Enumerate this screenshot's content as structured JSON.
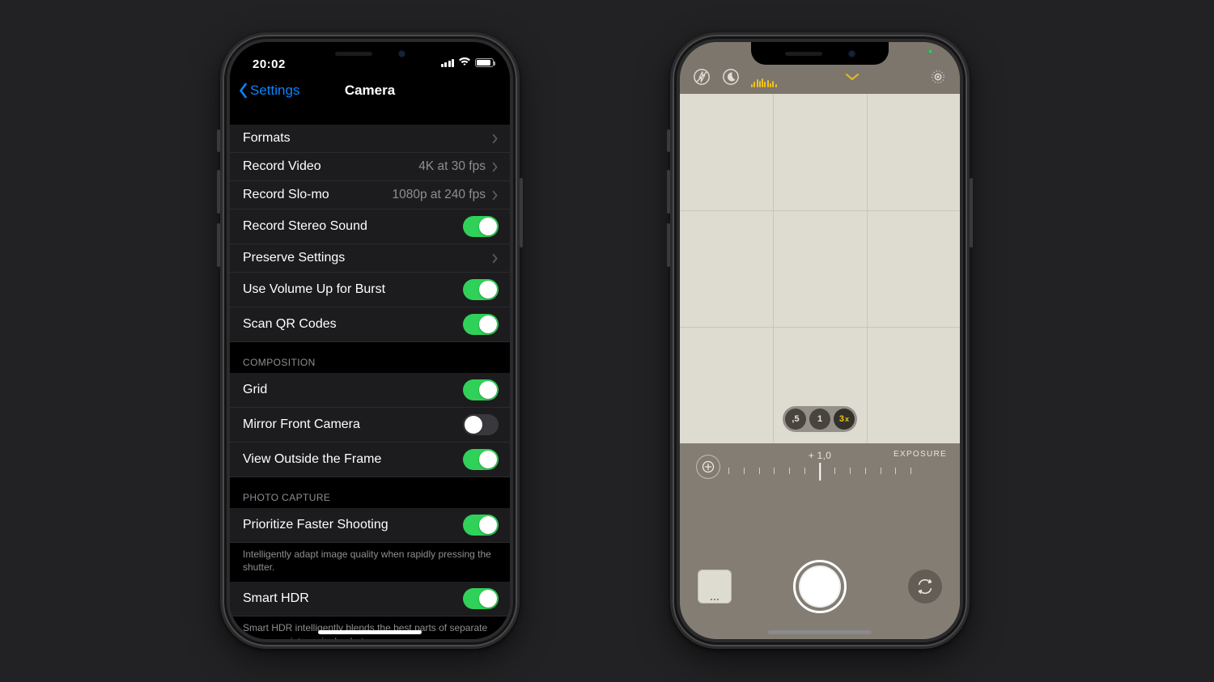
{
  "settings": {
    "status_time": "20:02",
    "back_label": "Settings",
    "title": "Camera",
    "rows": {
      "formats": "Formats",
      "record_video": "Record Video",
      "record_video_value": "4K at 30 fps",
      "record_slomo": "Record Slo-mo",
      "record_slomo_value": "1080p at 240 fps",
      "stereo": "Record Stereo Sound",
      "preserve": "Preserve Settings",
      "volume_burst": "Use Volume Up for Burst",
      "scan_qr": "Scan QR Codes"
    },
    "section_composition": "Composition",
    "composition": {
      "grid": "Grid",
      "mirror": "Mirror Front Camera",
      "outside": "View Outside the Frame"
    },
    "section_capture": "Photo Capture",
    "capture": {
      "faster": "Prioritize Faster Shooting",
      "faster_footer": "Intelligently adapt image quality when rapidly pressing the shutter.",
      "smart_hdr": "Smart HDR",
      "hdr_footer": "Smart HDR intelligently blends the best parts of separate exposures into a single photo."
    },
    "toggles": {
      "stereo": true,
      "volume_burst": true,
      "scan_qr": true,
      "grid": true,
      "mirror": false,
      "outside": true,
      "faster": true,
      "smart_hdr": true
    }
  },
  "camera": {
    "exposure_value": "+ 1,0",
    "exposure_label": "EXPOSURE",
    "zoom": {
      "wide": ",5",
      "main": "1",
      "tele": "3",
      "tele_suffix": "x",
      "active": "tele"
    }
  }
}
